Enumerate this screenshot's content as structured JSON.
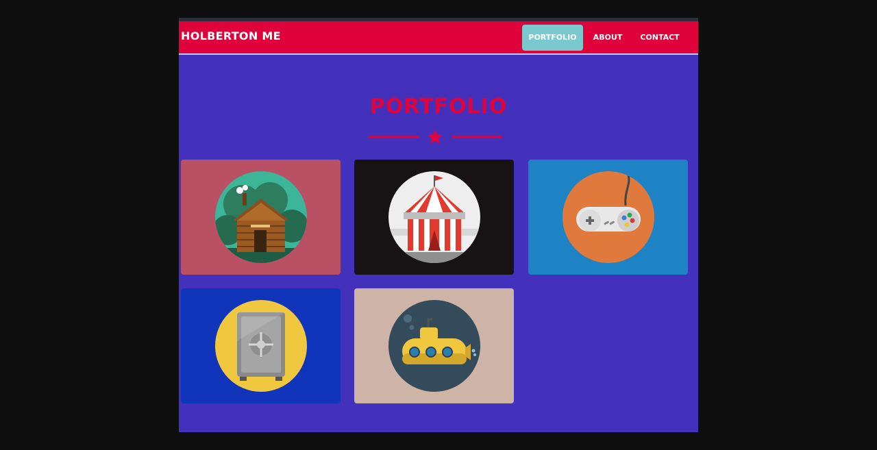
{
  "navbar": {
    "brand": "HOLBERTON ME",
    "items": [
      {
        "label": "PORTFOLIO",
        "active": true
      },
      {
        "label": "ABOUT",
        "active": false
      },
      {
        "label": "CONTACT",
        "active": false
      }
    ]
  },
  "portfolio": {
    "title": "PORTFOLIO",
    "divider_icon": "star-icon",
    "items": [
      {
        "icon": "cabin-icon",
        "background": "#b95064"
      },
      {
        "icon": "circus-tent-icon",
        "background": "#171314"
      },
      {
        "icon": "game-controller-icon",
        "background": "#1e83c4"
      },
      {
        "icon": "safe-icon",
        "background": "#1035bb"
      },
      {
        "icon": "submarine-icon",
        "background": "#ceb4a7"
      }
    ]
  },
  "colors": {
    "page_background": "#4331bc",
    "accent": "#e0023a",
    "active_nav": "#79c9cf",
    "outer_background": "#0f0f0f"
  }
}
